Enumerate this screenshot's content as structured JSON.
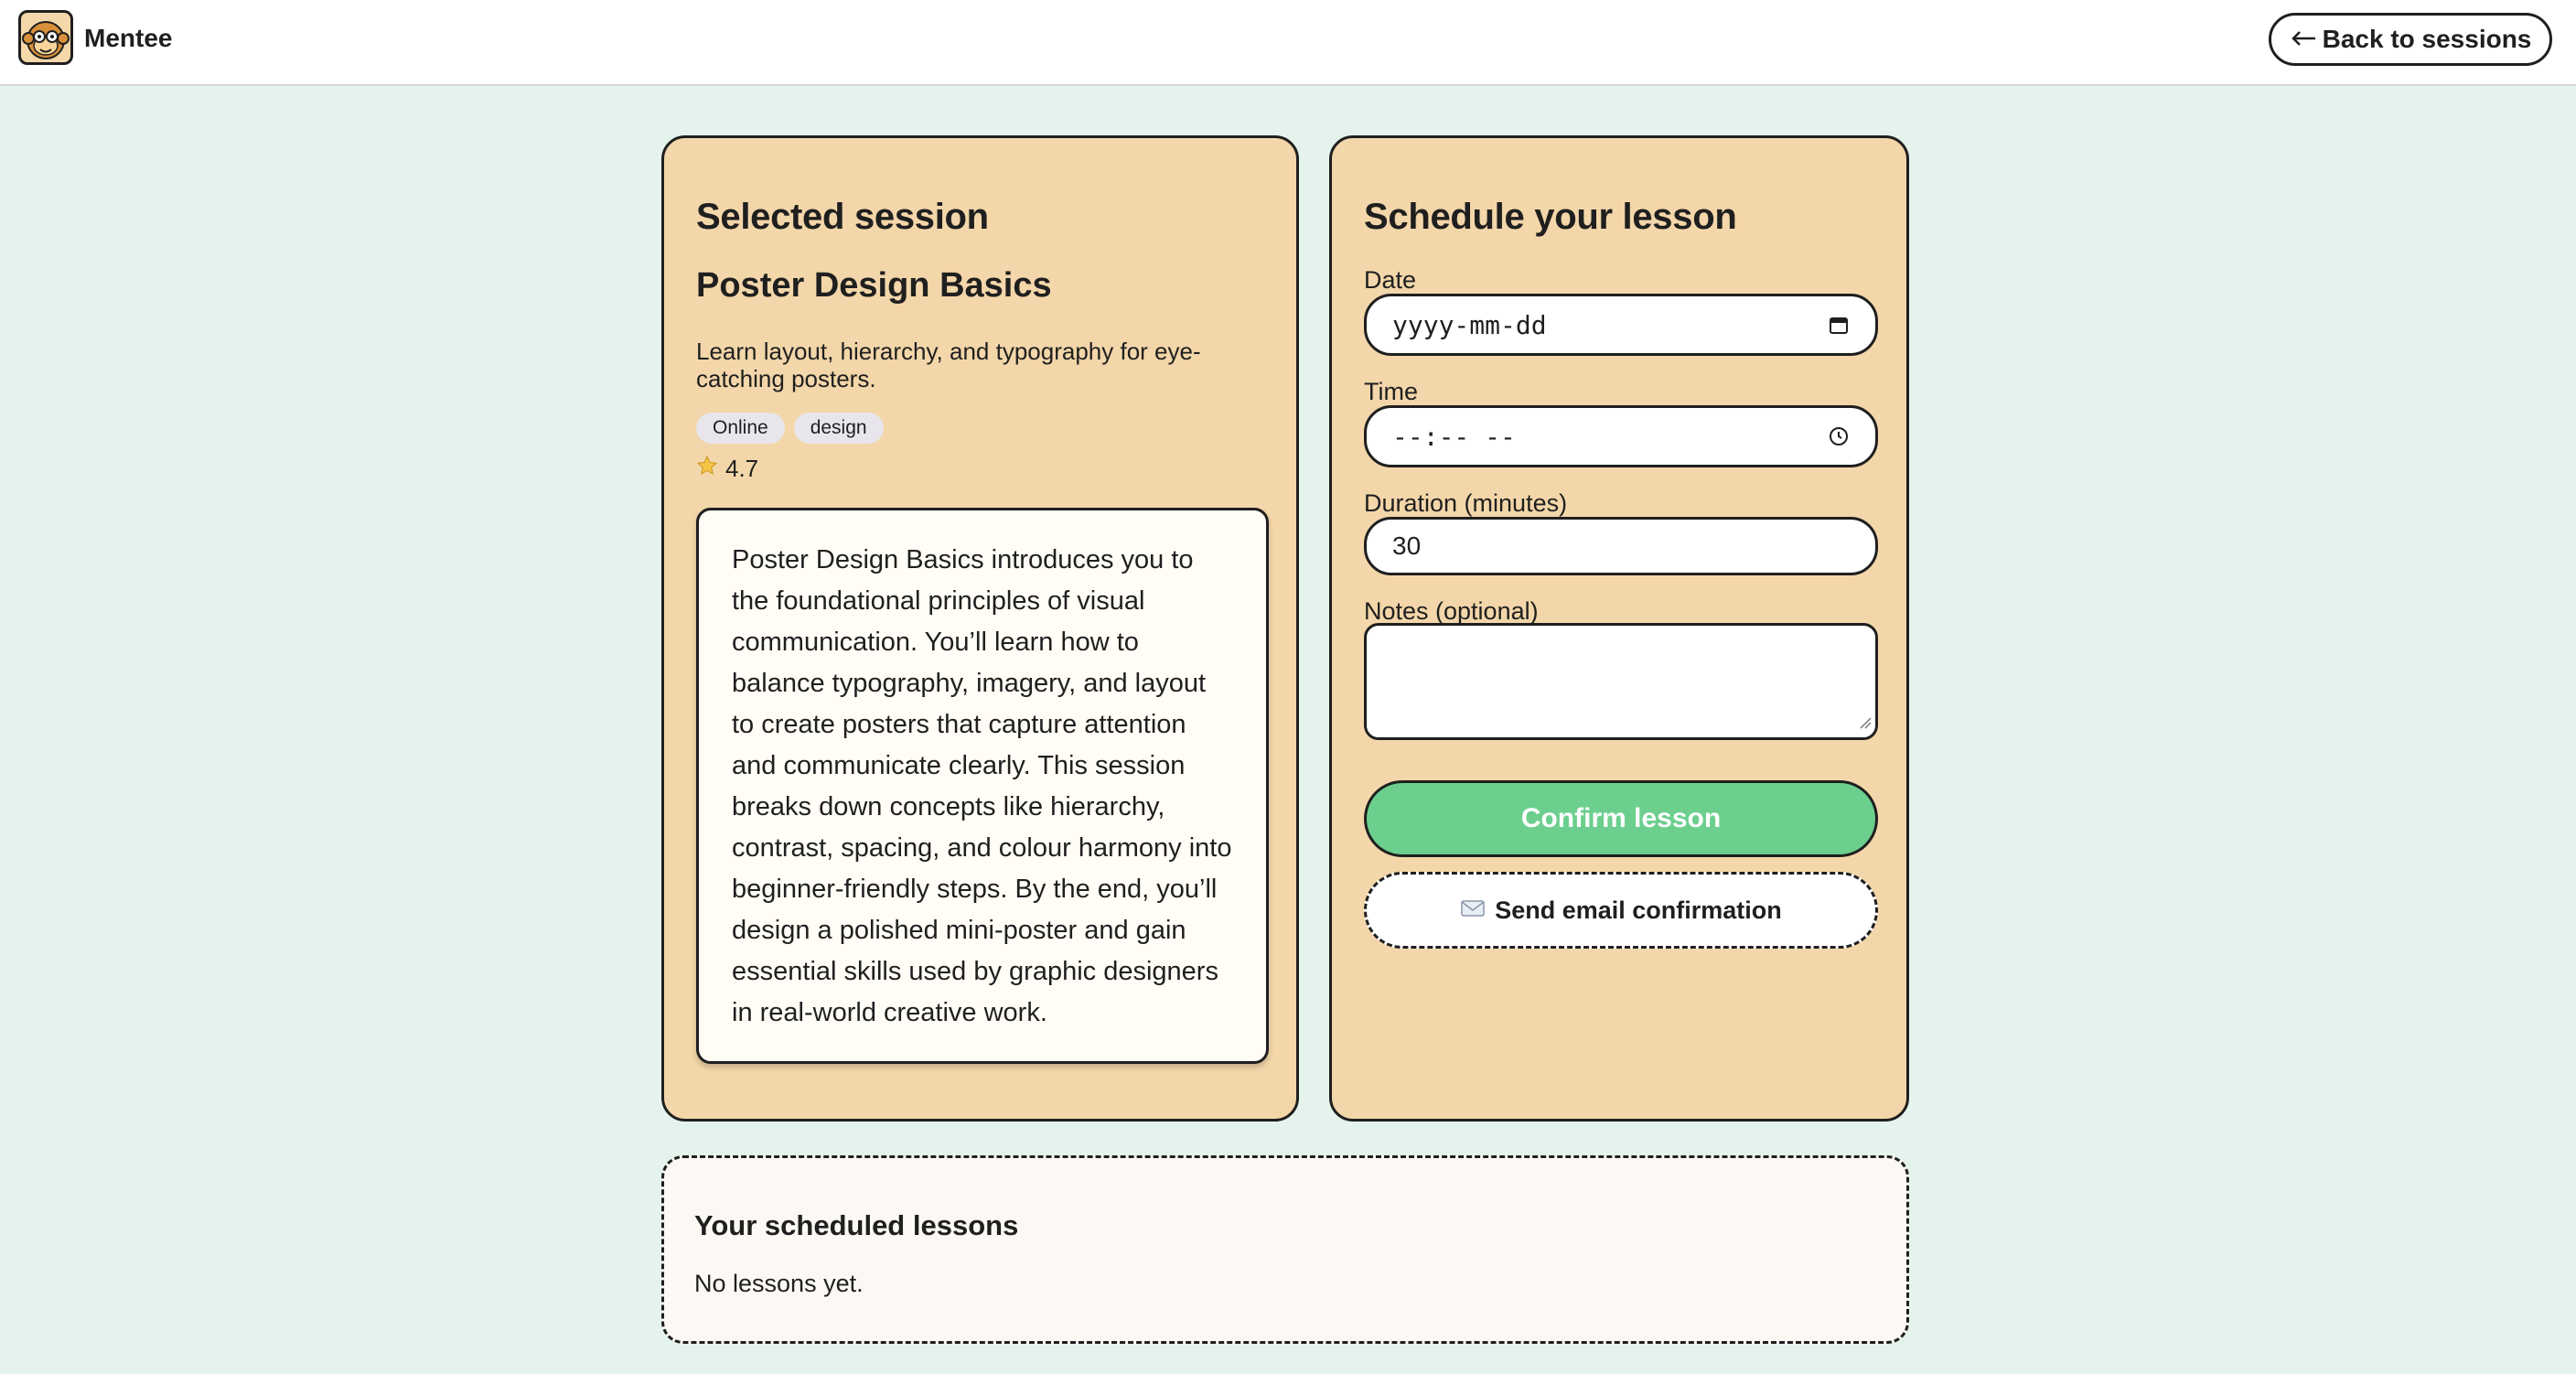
{
  "header": {
    "brand": "Mentee",
    "back_label": "Back to sessions",
    "back_icon": "arrow-left-icon",
    "logo_icon": "monkey-logo-icon"
  },
  "session": {
    "section_title": "Selected session",
    "name": "Poster Design Basics",
    "summary": "Learn layout, hierarchy, and typography for eye-catching posters.",
    "tags": [
      "Online",
      "design"
    ],
    "rating": "4.7",
    "rating_icon": "star-icon",
    "description": "Poster Design Basics introduces you to the foundational principles of visual communication. You’ll learn how to balance typography, imagery, and layout to create posters that capture attention and communicate clearly. This session breaks down concepts like hierarchy, contrast, spacing, and colour harmony into beginner-friendly steps. By the end, you’ll design a polished mini-poster and gain essential skills used by graphic designers in real-world creative work."
  },
  "schedule": {
    "title": "Schedule your lesson",
    "date_label": "Date",
    "date_placeholder": "yyyy-mm-dd",
    "time_label": "Time",
    "time_placeholder": "--:-- --",
    "duration_label": "Duration (minutes)",
    "duration_value": "30",
    "notes_label": "Notes (optional)",
    "notes_value": "",
    "confirm_label": "Confirm lesson",
    "email_label": "Send email confirmation",
    "email_icon": "envelope-icon"
  },
  "lessons": {
    "title": "Your scheduled lessons",
    "empty_text": "No lessons yet."
  },
  "colors": {
    "page_bg": "#e4f4ec",
    "card_bg": "#f3d6a9",
    "confirm_bg": "#6ccf8e",
    "lessons_bg": "#fcf9f4"
  }
}
